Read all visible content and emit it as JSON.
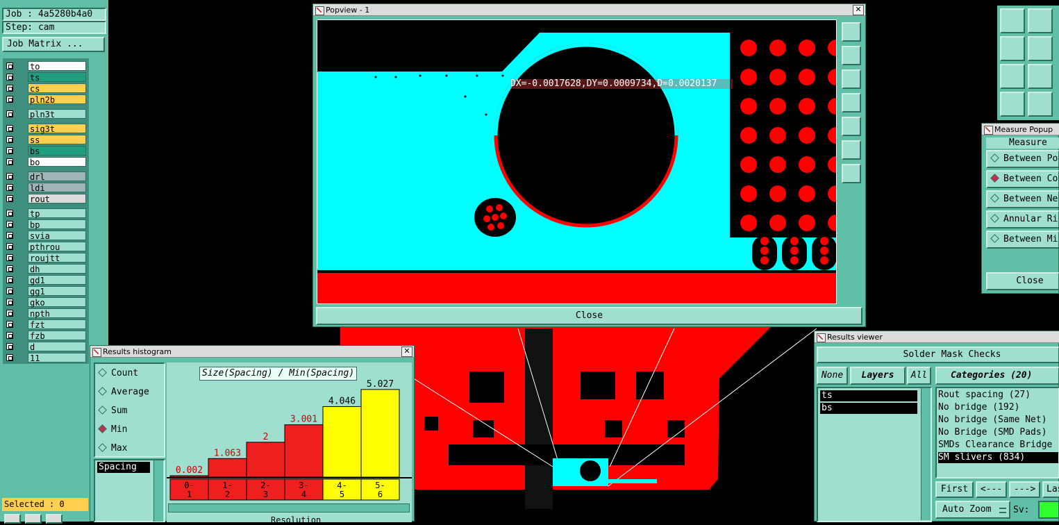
{
  "job_panel": {
    "job_label": "Job : 4a5280b4a0",
    "step_label": "Step: cam",
    "matrix_button": "Job Matrix ...",
    "selected_label": "Selected : 0"
  },
  "layers": [
    {
      "name": "to",
      "color": "#ffffff"
    },
    {
      "name": "ts",
      "color": "#1f9f7f"
    },
    {
      "name": "cs",
      "color": "#ffcf4f"
    },
    {
      "name": "pln2b",
      "color": "#ffcf4f"
    },
    {
      "name": "pln3t",
      "color": "#9fdfcf"
    },
    {
      "name": "sig3t",
      "color": "#ffcf4f"
    },
    {
      "name": "ss",
      "color": "#ffcf4f"
    },
    {
      "name": "bs",
      "color": "#1f9f7f"
    },
    {
      "name": "bo",
      "color": "#ffffff"
    },
    {
      "name": "drl",
      "color": "#9fb4b4"
    },
    {
      "name": "ldi",
      "color": "#9fb4b4"
    },
    {
      "name": "rout",
      "color": "#dcdcdc"
    },
    {
      "name": "tp",
      "color": "#9fdfcf"
    },
    {
      "name": "bp",
      "color": "#9fdfcf"
    },
    {
      "name": "svia",
      "color": "#9fdfcf"
    },
    {
      "name": "pthrou",
      "color": "#9fdfcf"
    },
    {
      "name": "roujtt",
      "color": "#9fdfcf"
    },
    {
      "name": "dh",
      "color": "#9fdfcf"
    },
    {
      "name": "gd1",
      "color": "#9fdfcf"
    },
    {
      "name": "gg1",
      "color": "#9fdfcf"
    },
    {
      "name": "gko",
      "color": "#9fdfcf"
    },
    {
      "name": "npth",
      "color": "#9fdfcf"
    },
    {
      "name": "fzt",
      "color": "#9fdfcf"
    },
    {
      "name": "fzb",
      "color": "#9fdfcf"
    },
    {
      "name": "d",
      "color": "#9fdfcf"
    },
    {
      "name": "11",
      "color": "#9fdfcf"
    }
  ],
  "popview": {
    "title": "Popview - 1",
    "measure_text": "DX=-0.0017628,DY=0.0009734,D=0.0020137",
    "close_label": "Close"
  },
  "measure_popup": {
    "title": "Measure Popup",
    "header": "Measure",
    "options": [
      {
        "label": "Between Po",
        "selected": false
      },
      {
        "label": "Between Co",
        "selected": true
      },
      {
        "label": "Between Ne",
        "selected": false
      },
      {
        "label": "Annular Ri",
        "selected": false
      },
      {
        "label": "Between Mi",
        "selected": false
      }
    ],
    "close_label": "Close"
  },
  "histogram": {
    "title": "Results histogram",
    "options": [
      {
        "label": "Count",
        "selected": false
      },
      {
        "label": "Average",
        "selected": false
      },
      {
        "label": "Sum",
        "selected": false
      },
      {
        "label": "Min",
        "selected": true
      },
      {
        "label": "Max",
        "selected": false
      }
    ],
    "list_item": "Spacing",
    "chart_title": "Size(Spacing) / Min(Spacing)",
    "bottom_label": "Resolution"
  },
  "chart_data": {
    "type": "bar",
    "title": "Size(Spacing) / Min(Spacing)",
    "categories": [
      "0-1",
      "1-2",
      "2-3",
      "3-4",
      "4-5",
      "5-6"
    ],
    "values": [
      0.002,
      1.063,
      2,
      3.001,
      4.046,
      5.027
    ],
    "value_labels": [
      "0.002",
      "1.063",
      "2",
      "3.001",
      "4.046",
      "5.027"
    ],
    "category_labels": [
      [
        "0-",
        "1"
      ],
      [
        "1-",
        "2"
      ],
      [
        "2-",
        "3"
      ],
      [
        "3-",
        "4"
      ],
      [
        "4-",
        "5"
      ],
      [
        "5-",
        "6"
      ]
    ],
    "colors": [
      "#f01f1f",
      "#f01f1f",
      "#f01f1f",
      "#f01f1f",
      "#ffff00",
      "#ffff00"
    ],
    "ylim": [
      0,
      5.1
    ]
  },
  "results_viewer": {
    "title": "Results viewer",
    "header": "Solder Mask Checks",
    "btn_none": "None",
    "btn_layers": "Layers",
    "btn_all": "All",
    "layers": [
      "ts",
      "bs"
    ],
    "categories_header": "Categories (20)",
    "categories": [
      {
        "label": "Rout spacing (27)",
        "selected": false
      },
      {
        "label": "No bridge (192)",
        "selected": false
      },
      {
        "label": "No bridge (Same Net)",
        "selected": false
      },
      {
        "label": "No Bridge (SMD Pads)",
        "selected": false
      },
      {
        "label": "SMDs Clearance Bridge",
        "selected": false
      },
      {
        "label": "SM slivers (834)",
        "selected": true
      }
    ],
    "btn_first": "First",
    "btn_prev": "<---",
    "btn_next": "--->",
    "btn_last": "Last",
    "zoom_label": "Auto Zoom",
    "sv_label": "Sv:"
  },
  "colors": {
    "teal": "#5fbfa7",
    "light_teal": "#9fdfcf",
    "copper_red": "#ff0000",
    "cyan": "#00ffff"
  }
}
